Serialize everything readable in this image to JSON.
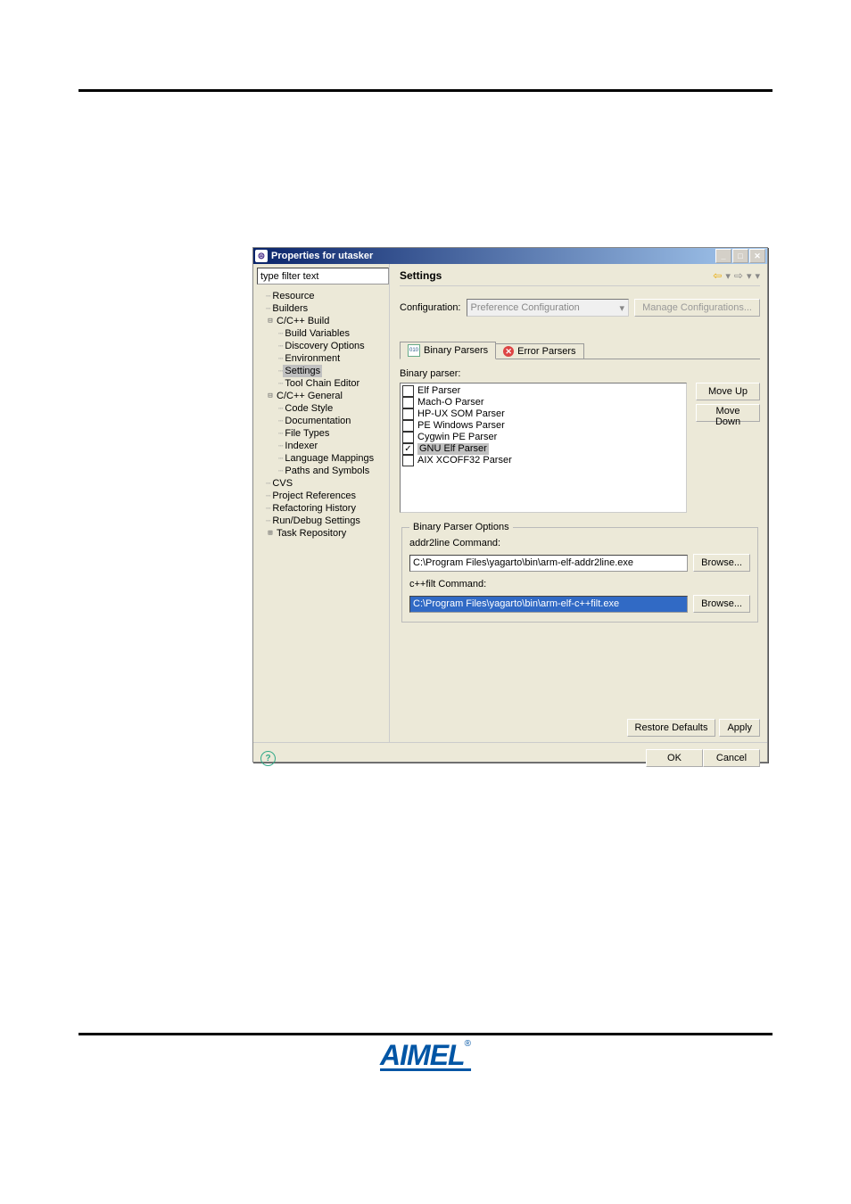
{
  "titlebar": {
    "title": "Properties for utasker"
  },
  "filter_placeholder": "type filter text",
  "tree": {
    "resource": "Resource",
    "builders": "Builders",
    "ccbuild": "C/C++ Build",
    "build_vars": "Build Variables",
    "discovery": "Discovery Options",
    "environment": "Environment",
    "settings": "Settings",
    "toolchain": "Tool Chain Editor",
    "ccgeneral": "C/C++ General",
    "codestyle": "Code Style",
    "documentation": "Documentation",
    "filetypes": "File Types",
    "indexer": "Indexer",
    "langmap": "Language Mappings",
    "paths": "Paths and Symbols",
    "cvs": "CVS",
    "projref": "Project References",
    "refactor": "Refactoring History",
    "rundebug": "Run/Debug Settings",
    "taskrepo": "Task Repository"
  },
  "right": {
    "title": "Settings",
    "config_label": "Configuration:",
    "config_value": "Preference Configuration",
    "manage_btn": "Manage Configurations...",
    "tab_binary": "Binary Parsers",
    "tab_error": "Error Parsers",
    "bp_label": "Binary parser:",
    "parsers": [
      {
        "name": "Elf Parser",
        "checked": false
      },
      {
        "name": "Mach-O Parser",
        "checked": false
      },
      {
        "name": "HP-UX SOM Parser",
        "checked": false
      },
      {
        "name": "PE Windows Parser",
        "checked": false
      },
      {
        "name": "Cygwin PE Parser",
        "checked": false
      },
      {
        "name": "GNU Elf Parser",
        "checked": true,
        "selected": true
      },
      {
        "name": "AIX XCOFF32 Parser",
        "checked": false
      }
    ],
    "move_up": "Move Up",
    "move_down": "Move Down",
    "opts_legend": "Binary Parser Options",
    "addr2line_label": "addr2line Command:",
    "addr2line_value": "C:\\Program Files\\yagarto\\bin\\arm-elf-addr2line.exe",
    "cppfilt_label": "c++filt Command:",
    "cppfilt_value": "C:\\Program Files\\yagarto\\bin\\arm-elf-c++filt.exe",
    "browse": "Browse...",
    "restore": "Restore Defaults",
    "apply": "Apply"
  },
  "footer": {
    "ok": "OK",
    "cancel": "Cancel"
  }
}
